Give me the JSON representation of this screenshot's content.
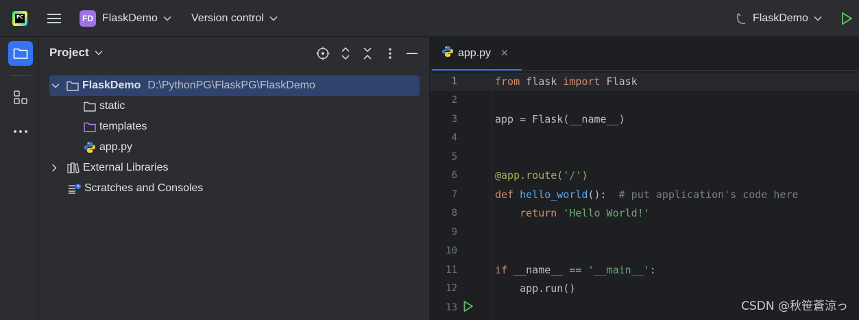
{
  "titlebar": {
    "logo_text": "PC",
    "project_badge": "FD",
    "project_name": "FlaskDemo",
    "vcs_label": "Version control",
    "run_config": "FlaskDemo"
  },
  "project_panel": {
    "title": "Project",
    "tree": [
      {
        "label": "FlaskDemo",
        "path": "D:\\PythonPG\\FlaskPG\\FlaskDemo"
      },
      {
        "label": "static"
      },
      {
        "label": "templates"
      },
      {
        "label": "app.py"
      },
      {
        "label": "External Libraries"
      },
      {
        "label": "Scratches and Consoles"
      }
    ]
  },
  "editor": {
    "tab_label": "app.py",
    "line_numbers": [
      "1",
      "2",
      "3",
      "4",
      "5",
      "6",
      "7",
      "8",
      "9",
      "10",
      "11",
      "12",
      "13"
    ],
    "lines": [
      {
        "a": "from",
        "b": " flask ",
        "c": "import",
        "d": " Flask"
      },
      {},
      {
        "a": "app = Flask(__name__)"
      },
      {},
      {},
      {
        "a": "@app.route(",
        "b": "'/'",
        "c": ")"
      },
      {
        "a": "def",
        "b": " ",
        "c": "hello_world",
        "d": "():  ",
        "e": "# put application's code here"
      },
      {
        "a": "    ",
        "b": "return",
        "c": " ",
        "d": "'Hello World!'"
      },
      {},
      {},
      {
        "a": "if",
        "b": " __name__ == ",
        "c": "'__main__'",
        "d": ":"
      },
      {
        "a": "    app.run()"
      },
      {}
    ]
  },
  "watermark": "CSDN @秋笹蒼涼っ",
  "colors": {
    "accent": "#3574f0",
    "keyword": "#cf8e6d",
    "string": "#6aab73",
    "comment": "#7a7e85",
    "function": "#56a8f5",
    "run_green": "#5fb865"
  }
}
